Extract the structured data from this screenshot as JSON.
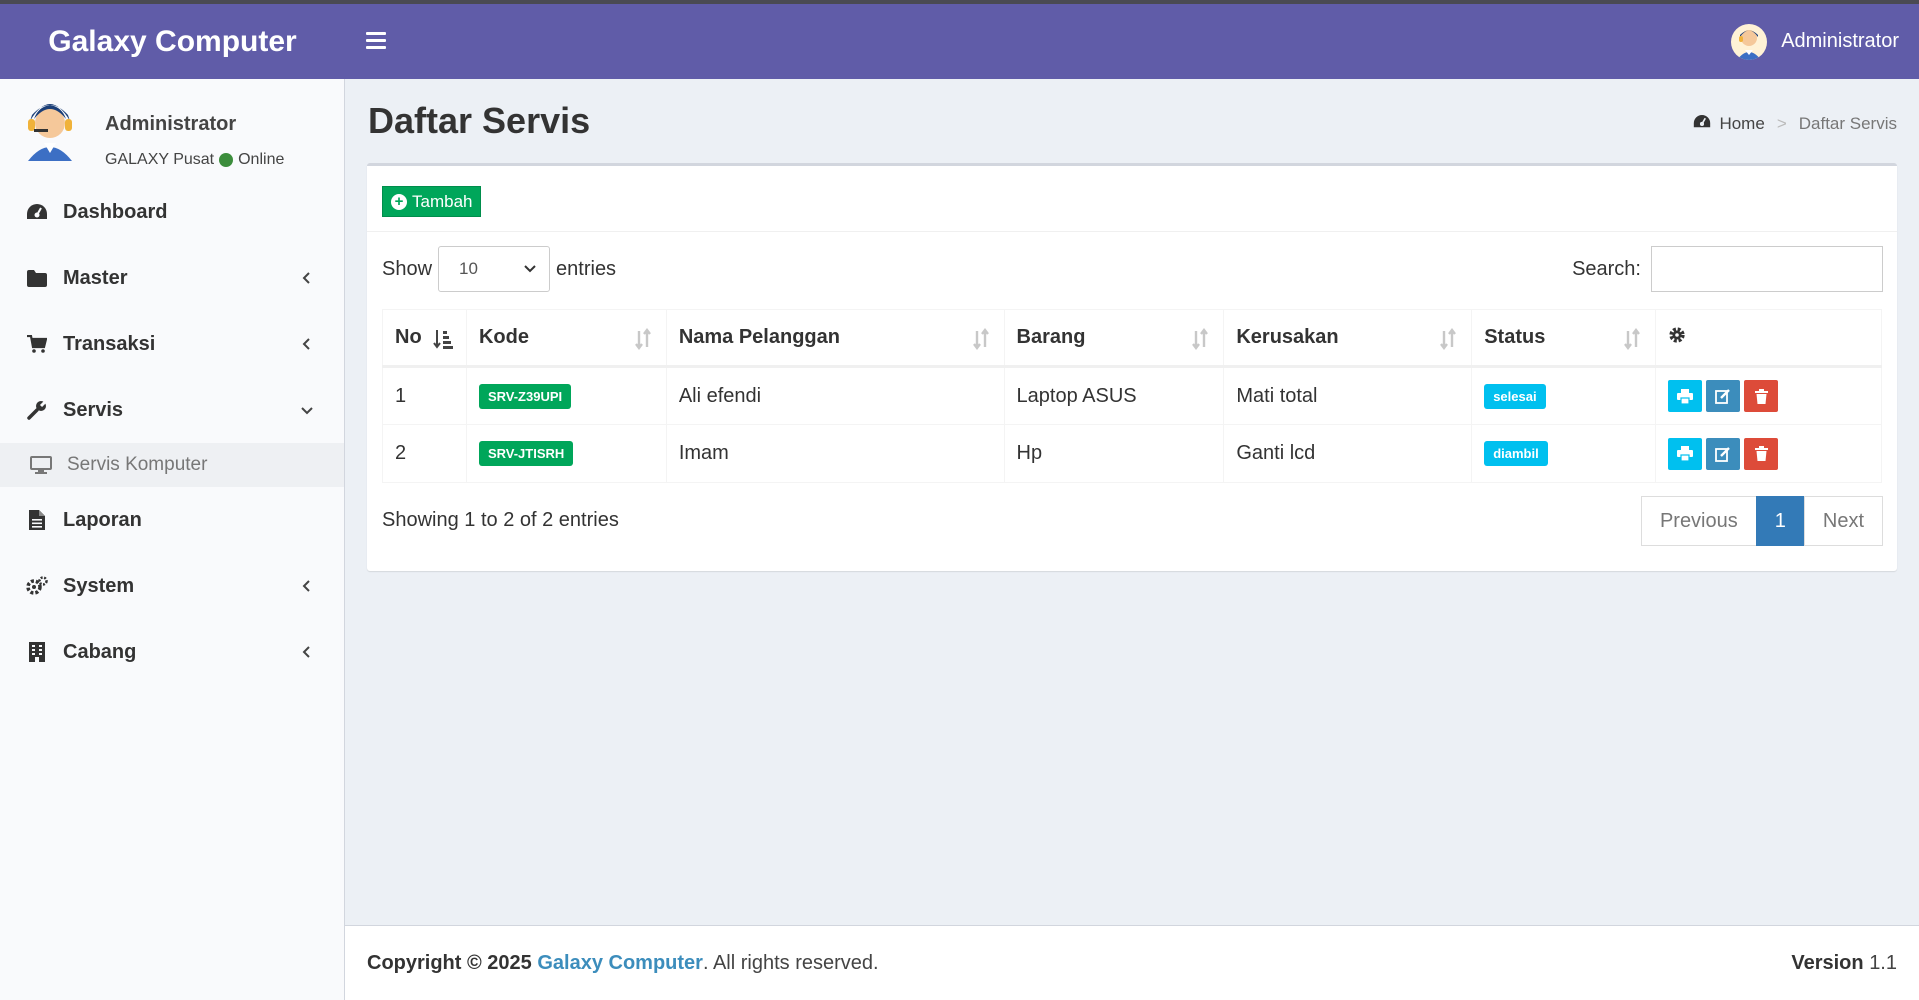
{
  "header": {
    "brand": "Galaxy Computer",
    "user_name": "Administrator",
    "accent_color": "#605ca8"
  },
  "sidebar": {
    "user": {
      "name": "Administrator",
      "branch": "GALAXY Pusat",
      "status": "Online"
    },
    "items": [
      {
        "label": "Dashboard",
        "icon": "dashboard-icon"
      },
      {
        "label": "Master",
        "icon": "folder-icon"
      },
      {
        "label": "Transaksi",
        "icon": "cart-icon"
      },
      {
        "label": "Servis",
        "icon": "wrench-icon",
        "expanded": true
      },
      {
        "label": "Servis Komputer",
        "icon": "monitor-icon",
        "active": true
      },
      {
        "label": "Laporan",
        "icon": "file-icon"
      },
      {
        "label": "System",
        "icon": "cogs-icon"
      },
      {
        "label": "Cabang",
        "icon": "building-icon"
      }
    ]
  },
  "page": {
    "title": "Daftar Servis",
    "breadcrumb": {
      "home": "Home",
      "current": "Daftar Servis"
    }
  },
  "toolbar": {
    "add_label": "Tambah"
  },
  "table_controls": {
    "show_label": "Show",
    "entries_value": "10",
    "entries_label": "entries",
    "search_label": "Search:",
    "search_value": ""
  },
  "table": {
    "columns": [
      "No",
      "Kode",
      "Nama Pelanggan",
      "Barang",
      "Kerusakan",
      "Status"
    ],
    "rows": [
      {
        "no": "1",
        "kode": "SRV-Z39UPI",
        "nama": "Ali efendi",
        "barang": "Laptop ASUS",
        "kerusakan": "Mati total",
        "status": "selesai"
      },
      {
        "no": "2",
        "kode": "SRV-JTISRH",
        "nama": "Imam",
        "barang": "Hp",
        "kerusakan": "Ganti lcd",
        "status": "diambil"
      }
    ]
  },
  "pagination": {
    "info": "Showing 1 to 2 of 2 entries",
    "previous": "Previous",
    "current": "1",
    "next": "Next"
  },
  "footer": {
    "copyright_prefix": "Copyright © 2025",
    "brand": "Galaxy Computer",
    "rights": ". All rights reserved.",
    "version_label": "Version",
    "version_value": "1.1"
  }
}
